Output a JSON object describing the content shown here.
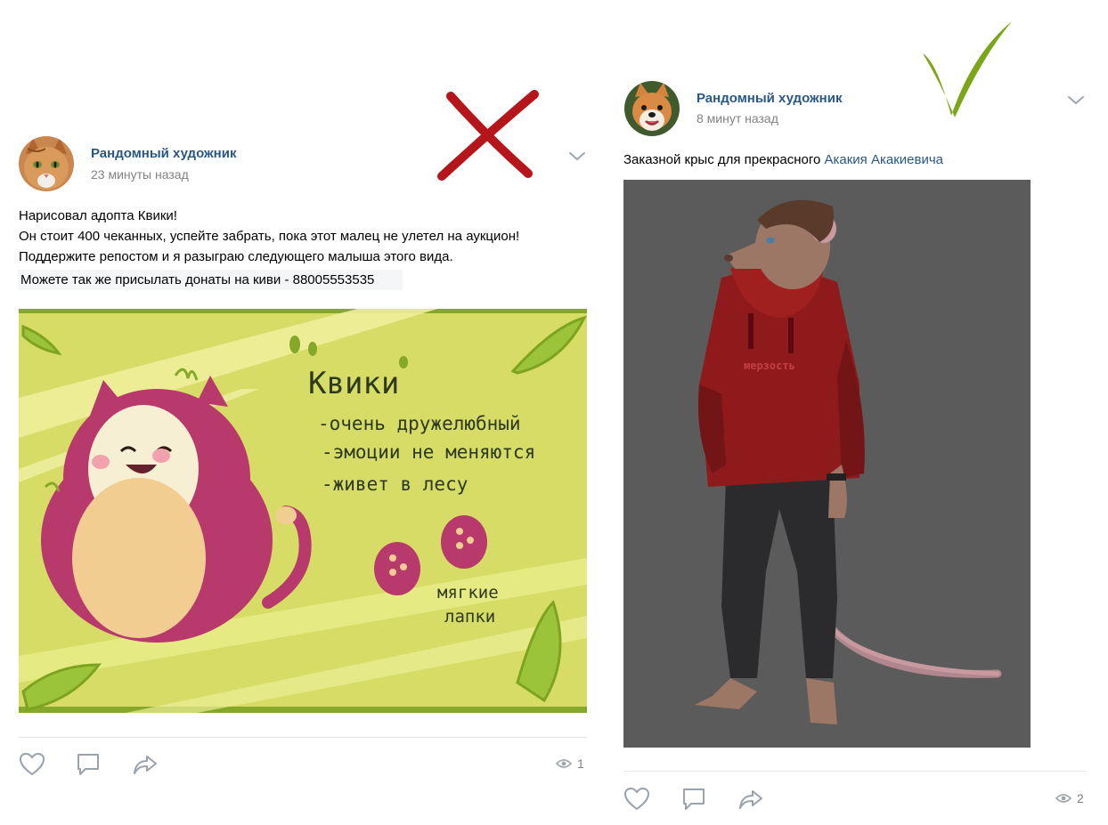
{
  "posts": [
    {
      "author": "Рандомный художник",
      "time": "23 минуты назад",
      "avatar_icon": "orange-cat-avatar",
      "lines": [
        "Нарисовал адопта Квики!",
        "Он стоит 400 чеканных, успейте забрать, пока этот малец не улетел на аукцион!",
        "Поддержите репостом и я разыграю следующего малыша этого вида.",
        "Можете так же присылать донаты на киви - 88005553535"
      ],
      "image": {
        "title": "Квики",
        "features": [
          "-очень дружелюбный",
          "-эмоции не меняются",
          "-живет в лесу"
        ],
        "paws_caption_1": "мягкие",
        "paws_caption_2": "лапки",
        "background_color": "#d6dc66",
        "creature_color": "#b83a6c"
      },
      "views": "1",
      "verdict_icon": "red-cross-mark"
    },
    {
      "author": "Рандомный художник",
      "time": "8 минут назад",
      "avatar_icon": "shiba-dog-avatar",
      "text_prefix": "Заказной крыс для прекрасного ",
      "text_link": "Акакия Акакиевича",
      "image": {
        "hoodie_text": "мерзость",
        "background_color": "#5b5b5b",
        "hoodie_color": "#8e1a1c"
      },
      "views": "2",
      "verdict_icon": "green-check-mark"
    }
  ],
  "icons": {
    "like": "heart-icon",
    "comment": "comment-icon",
    "share": "share-icon",
    "views": "eye-icon",
    "menu": "chevron-down-icon"
  },
  "colors": {
    "link": "#2a5885",
    "meta": "#828282",
    "cross": "#b4161b",
    "check": "#7ca619"
  }
}
